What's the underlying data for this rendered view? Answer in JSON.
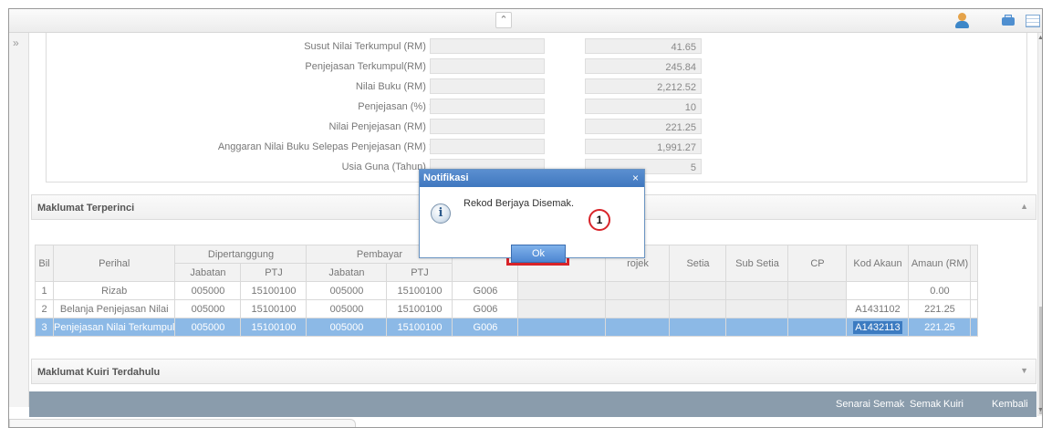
{
  "fields": [
    {
      "label": "Susut Nilai Terkumpul (RM) :",
      "value": "41.65"
    },
    {
      "label": "Penjejasan Terkumpul(RM) :",
      "value": "245.84"
    },
    {
      "label": "Nilai Buku (RM) :",
      "value": "2,212.52"
    },
    {
      "label": "Penjejasan (%) :",
      "value": "10"
    },
    {
      "label": "Nilai Penjejasan (RM) :",
      "value": "221.25"
    },
    {
      "label": "Anggaran Nilai Buku Selepas Penjejasan (RM) :",
      "value": "1,991.27"
    },
    {
      "label": "Usia Guna (Tahun) :",
      "value": "5"
    }
  ],
  "section_terperinci": "Maklumat Terperinci",
  "section_kuiri": "Maklumat Kuiri Terdahulu",
  "table": {
    "headers": {
      "bil": "Bil",
      "perihal": "Perihal",
      "dipertanggung": "Dipertanggung",
      "pembayar": "Pembayar",
      "jabatan": "Jabatan",
      "ptj": "PTJ",
      "projek": "rojek",
      "setia": "Setia",
      "sub_setia": "Sub Setia",
      "cp": "CP",
      "kod_akaun": "Kod Akaun",
      "amaun": "Amaun (RM)"
    },
    "rows": [
      {
        "bil": "1",
        "perihal": "Rizab",
        "d_jabatan": "005000",
        "d_ptj": "15100100",
        "p_jabatan": "005000",
        "p_ptj": "15100100",
        "code": "G006",
        "kod_akaun": "",
        "amaun": "0.00"
      },
      {
        "bil": "2",
        "perihal": "Belanja Penjejasan Nilai",
        "d_jabatan": "005000",
        "d_ptj": "15100100",
        "p_jabatan": "005000",
        "p_ptj": "15100100",
        "code": "G006",
        "kod_akaun": "A1431102",
        "amaun": "221.25"
      },
      {
        "bil": "3",
        "perihal": "Penjejasan Nilai Terkumpul",
        "d_jabatan": "005000",
        "d_ptj": "15100100",
        "p_jabatan": "005000",
        "p_ptj": "15100100",
        "code": "G006",
        "kod_akaun": "A1432113",
        "amaun": "221.25"
      }
    ]
  },
  "buttons": {
    "senarai_semak": "Senarai Semak",
    "semak": "Semak",
    "kuiri": "Kuiri",
    "kembali": "Kembali"
  },
  "modal": {
    "title": "Notifikasi",
    "close": "×",
    "message": "Rekod Berjaya Disemak.",
    "ok_label": "Ok",
    "icon": "info-icon"
  },
  "callout": {
    "number": "1",
    "color": "#d8242a"
  },
  "icons": {
    "collapse_top": "double-chevron-up",
    "expand_side": "double-chevron-right"
  },
  "colors": {
    "selected_row": "#8cb9e6",
    "bottom_bar": "#8a9cac",
    "modal_header": "#4a82c9"
  }
}
